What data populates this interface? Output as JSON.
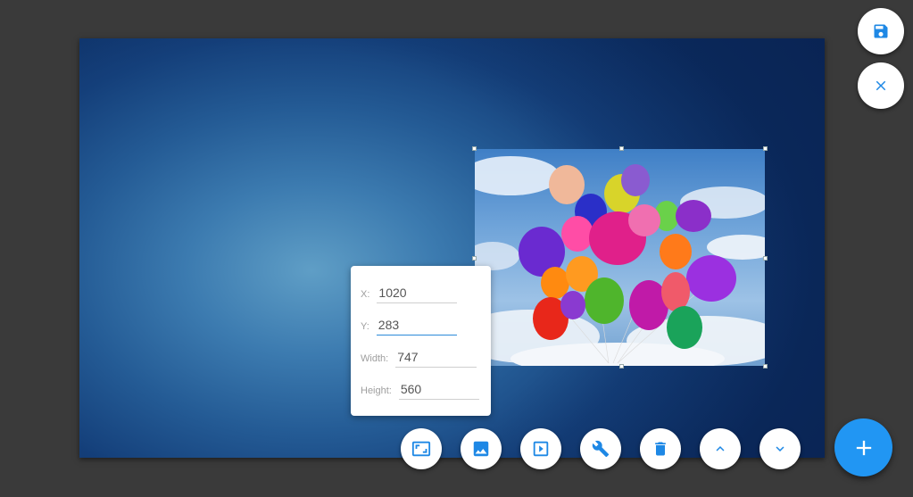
{
  "editor": {
    "accent_color": "#2196f3",
    "icon_color": "#1e88e5"
  },
  "properties": {
    "x_label": "X:",
    "x_value": "1020",
    "y_label": "Y:",
    "y_value": "283",
    "width_label": "Width:",
    "width_value": "747",
    "height_label": "Height:",
    "height_value": "560"
  },
  "top_actions": [
    {
      "icon": "save-icon"
    },
    {
      "icon": "close-icon"
    }
  ],
  "toolbar": [
    {
      "icon": "aspect-ratio-icon"
    },
    {
      "icon": "image-icon"
    },
    {
      "icon": "slideshow-icon"
    },
    {
      "icon": "wrench-icon"
    },
    {
      "icon": "delete-icon"
    },
    {
      "icon": "chevron-up-icon"
    },
    {
      "icon": "chevron-down-icon"
    }
  ],
  "add_button": {
    "icon": "add-icon"
  }
}
